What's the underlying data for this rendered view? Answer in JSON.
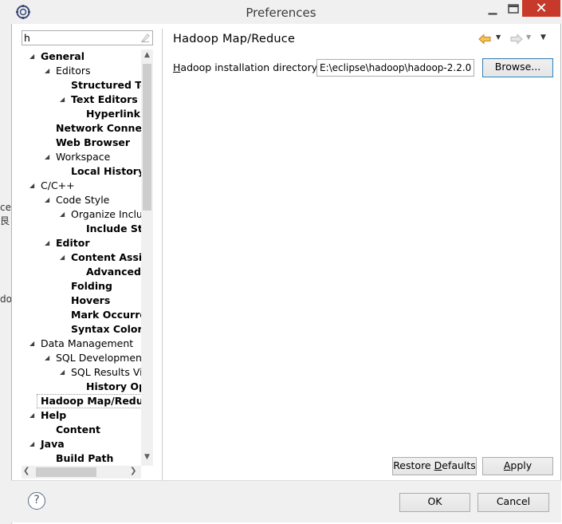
{
  "window": {
    "title": "Preferences",
    "minimize_glyph": "▁",
    "close_glyph": "✕"
  },
  "background_fragments": [
    "ce",
    "艮",
    "do"
  ],
  "filter": {
    "value": "h"
  },
  "tree": [
    {
      "label": "General",
      "bold": true,
      "arrow": "◢",
      "indent": 0
    },
    {
      "label": "Editors",
      "bold": false,
      "arrow": "◢",
      "indent": 1
    },
    {
      "label": "Structured Text",
      "bold": true,
      "arrow": "",
      "indent": 2
    },
    {
      "label": "Text Editors",
      "bold": true,
      "arrow": "◢",
      "indent": 2
    },
    {
      "label": "Hyperlinking",
      "bold": true,
      "arrow": "",
      "indent": 3
    },
    {
      "label": "Network Connections",
      "bold": true,
      "arrow": "",
      "indent": 1
    },
    {
      "label": "Web Browser",
      "bold": true,
      "arrow": "",
      "indent": 1
    },
    {
      "label": "Workspace",
      "bold": false,
      "arrow": "◢",
      "indent": 1
    },
    {
      "label": "Local History",
      "bold": true,
      "arrow": "",
      "indent": 2
    },
    {
      "label": "C/C++",
      "bold": false,
      "arrow": "◢",
      "indent": 0
    },
    {
      "label": "Code Style",
      "bold": false,
      "arrow": "◢",
      "indent": 1
    },
    {
      "label": "Organize Includes",
      "bold": false,
      "arrow": "◢",
      "indent": 2
    },
    {
      "label": "Include Style",
      "bold": true,
      "arrow": "",
      "indent": 3
    },
    {
      "label": "Editor",
      "bold": true,
      "arrow": "◢",
      "indent": 1
    },
    {
      "label": "Content Assist",
      "bold": true,
      "arrow": "◢",
      "indent": 2
    },
    {
      "label": "Advanced",
      "bold": true,
      "arrow": "",
      "indent": 3
    },
    {
      "label": "Folding",
      "bold": true,
      "arrow": "",
      "indent": 2
    },
    {
      "label": "Hovers",
      "bold": true,
      "arrow": "",
      "indent": 2
    },
    {
      "label": "Mark Occurrences",
      "bold": true,
      "arrow": "",
      "indent": 2
    },
    {
      "label": "Syntax Coloring",
      "bold": true,
      "arrow": "",
      "indent": 2
    },
    {
      "label": "Data Management",
      "bold": false,
      "arrow": "◢",
      "indent": 0
    },
    {
      "label": "SQL Development",
      "bold": false,
      "arrow": "◢",
      "indent": 1
    },
    {
      "label": "SQL Results View",
      "bold": false,
      "arrow": "◢",
      "indent": 2
    },
    {
      "label": "History Options",
      "bold": true,
      "arrow": "",
      "indent": 3
    },
    {
      "label": "Hadoop Map/Reduce",
      "bold": true,
      "arrow": "",
      "indent": 0,
      "selected": true
    },
    {
      "label": "Help",
      "bold": true,
      "arrow": "◢",
      "indent": 0
    },
    {
      "label": "Content",
      "bold": true,
      "arrow": "",
      "indent": 1
    },
    {
      "label": "Java",
      "bold": true,
      "arrow": "◢",
      "indent": 0
    },
    {
      "label": "Build Path",
      "bold": true,
      "arrow": "",
      "indent": 1
    }
  ],
  "page": {
    "title": "Hadoop Map/Reduce",
    "install_dir_label_first": "H",
    "install_dir_label_rest": "adoop installation directory:",
    "install_dir_value": "E:\\eclipse\\hadoop\\hadoop-2.2.0",
    "browse_button": "Browse...",
    "restore_defaults_pre": "Restore ",
    "restore_defaults_mnemonic": "D",
    "restore_defaults_post": "efaults",
    "apply_mnemonic": "A",
    "apply_rest": "pply"
  },
  "footer": {
    "help_glyph": "?",
    "ok_button": "OK",
    "cancel_button": "Cancel"
  },
  "colors": {
    "close_button": "#c7392b",
    "nav_back_arrow": "#e8a33a",
    "nav_fwd_arrow": "#b8b8b8",
    "default_button_border": "#3c7fb1"
  }
}
